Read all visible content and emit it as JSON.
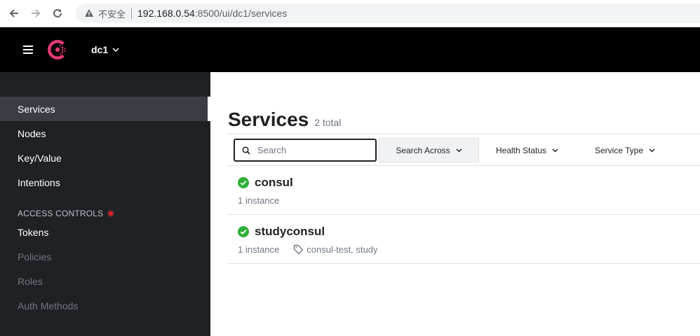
{
  "browser": {
    "insecure_label": "不安全",
    "url_host": "192.168.0.54",
    "url_rest": ":8500/ui/dc1/services"
  },
  "header": {
    "datacenter": "dc1"
  },
  "sidebar": {
    "items": [
      {
        "label": "Services"
      },
      {
        "label": "Nodes"
      },
      {
        "label": "Key/Value"
      },
      {
        "label": "Intentions"
      }
    ],
    "access_controls_heading": "ACCESS CONTROLS",
    "acl_items": [
      {
        "label": "Tokens"
      },
      {
        "label": "Policies"
      },
      {
        "label": "Roles"
      },
      {
        "label": "Auth Methods"
      }
    ]
  },
  "main": {
    "title": "Services",
    "total": "2 total",
    "search_placeholder": "Search",
    "search_across_label": "Search Across",
    "health_status_label": "Health Status",
    "service_type_label": "Service Type",
    "services": [
      {
        "name": "consul",
        "instances": "1 instance",
        "tags": ""
      },
      {
        "name": "studyconsul",
        "instances": "1 instance",
        "tags": "consul-test, study"
      }
    ]
  },
  "colors": {
    "brand": "#e03875",
    "passing": "#2eb039",
    "header_bg": "#000000",
    "sidebar_bg": "#1f2124"
  }
}
